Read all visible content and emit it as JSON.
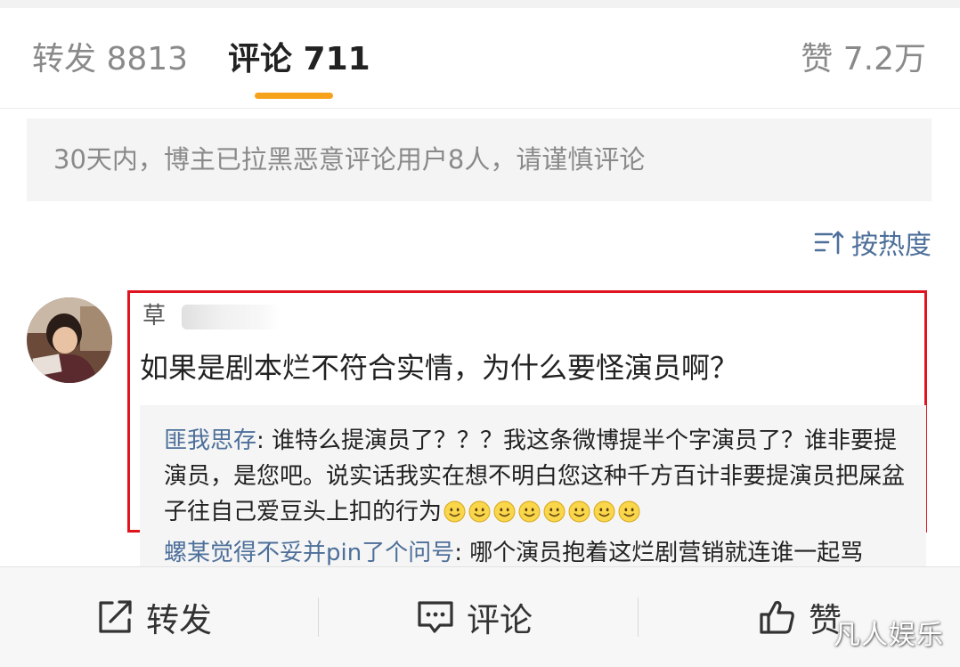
{
  "tabs": {
    "repost": "转发 8813",
    "comment": "评论 711",
    "like": "赞 7.2万"
  },
  "notice": "30天内，博主已拉黑恶意评论用户8人，请谨慎评论",
  "sort_label": "按热度",
  "comment": {
    "username": "草",
    "text": "如果是剧本烂不符合实情，为什么要怪演员啊？",
    "replies": [
      {
        "author": "匪我思存",
        "text": ": 谁特么提演员了？？？我这条微博提半个字演员了？谁非要提演员，是您吧。说实话我实在想不明白您这种千方百计非要提演员把屎盆子往自己爱豆头上扣的行为",
        "emoji_count": 8,
        "emoji_name": "smile-emoji"
      },
      {
        "author": "螺某觉得不妥并pin了个问号",
        "text": ": 哪个演员抱着这烂剧营销就连谁一起骂"
      }
    ]
  },
  "bottom_bar": {
    "repost": "转发",
    "comment": "评论",
    "like": "赞"
  },
  "watermark": "凡人娱乐",
  "colors": {
    "accent": "#f7a21b",
    "link": "#4d6f9a",
    "highlight_border": "#e0141e"
  }
}
